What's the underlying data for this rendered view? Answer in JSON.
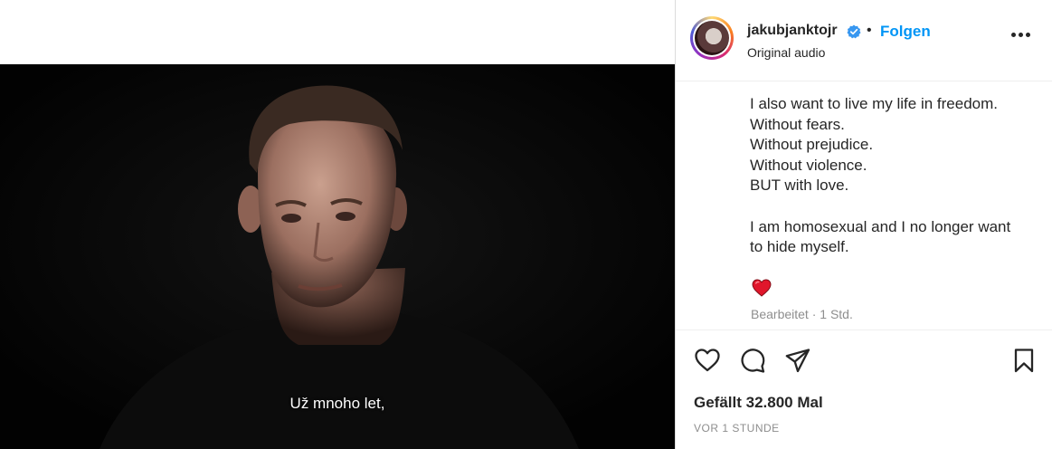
{
  "post": {
    "username": "jakubjanktojr",
    "follow_label": "Folgen",
    "separator": "•",
    "audio": "Original audio",
    "caption_lines": [
      "I also want to live my life in freedom.",
      "Without fears.",
      "Without prejudice.",
      "Without violence.",
      "BUT with love."
    ],
    "caption_lines_2": [
      "I am homosexual and I no longer want",
      "to hide myself."
    ],
    "edited": "Bearbeitet · 1 Std.",
    "likes": "Gefällt 32.800 Mal",
    "time": "VOR 1 STUNDE"
  },
  "video": {
    "subtitle": "Už mnoho let,"
  },
  "icons": {
    "verified": "verified-badge-icon",
    "more": "more-options-icon",
    "like": "heart-outline-icon",
    "comment": "comment-bubble-icon",
    "share": "paper-plane-icon",
    "save": "bookmark-icon",
    "caption_emoji": "red-heart-emoji-icon"
  },
  "colors": {
    "link": "#0095f6",
    "verified": "#3897f0",
    "muted": "#8e8e8e",
    "heart": "#e0162b"
  }
}
